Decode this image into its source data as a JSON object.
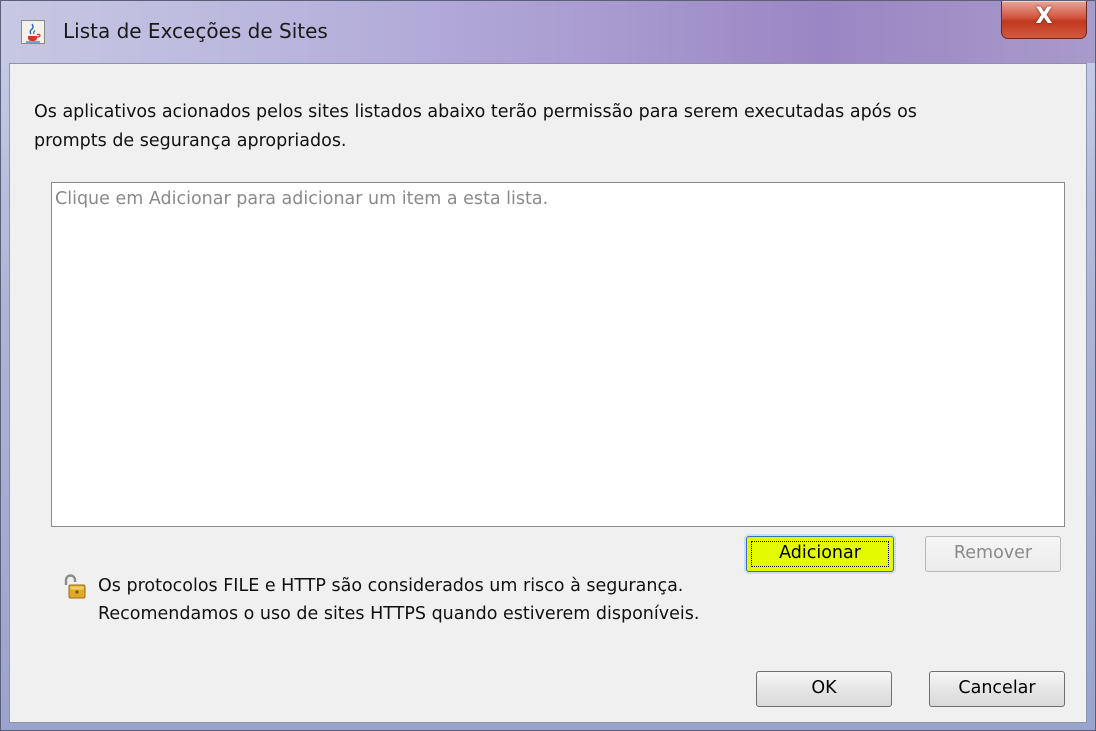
{
  "window": {
    "title": "Lista de Exceções de Sites",
    "close_glyph": "X",
    "title_icon": "java-cup-icon"
  },
  "description": {
    "line1": "Os aplicativos acionados pelos sites listados abaixo terão permissão para serem executadas após os",
    "line2": "prompts de segurança apropriados."
  },
  "site_list": {
    "placeholder": "Clique em Adicionar para adicionar um item a esta lista."
  },
  "list_buttons": {
    "add_label": "Adicionar",
    "remove_label": "Remover"
  },
  "warning": {
    "icon": "unlocked-padlock-icon",
    "line1": "Os protocolos FILE e HTTP são considerados um risco à segurança.",
    "line2": "Recomendamos o uso de sites HTTPS quando estiverem disponíveis."
  },
  "footer": {
    "ok_label": "OK",
    "cancel_label": "Cancelar"
  },
  "colors": {
    "add_button_highlight": "#e4fa00",
    "close_button": "#c7432a",
    "dialog_background": "#f0f0f0"
  }
}
